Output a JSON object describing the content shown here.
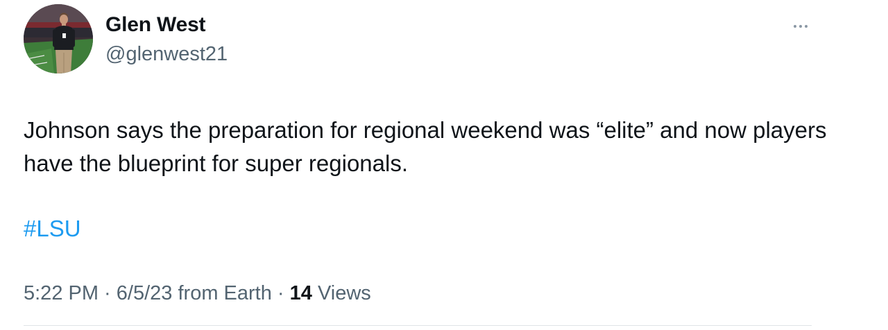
{
  "author": {
    "display_name": "Glen West",
    "handle": "@glenwest21"
  },
  "tweet": {
    "text": "Johnson says the preparation for regional weekend was “elite” and now players have the blueprint for super regionals.",
    "hashtag": "#LSU"
  },
  "meta": {
    "time": "5:22 PM",
    "sep1": " · ",
    "date": "6/5/23",
    "source": " from Earth",
    "sep2": " · ",
    "views_count": "14",
    "views_label": " Views"
  },
  "icons": {
    "more": "more-horizontal-icon"
  },
  "colors": {
    "text": "#0f1419",
    "secondary": "#536471",
    "link": "#1d9bf0",
    "divider": "#dfe3e6"
  }
}
